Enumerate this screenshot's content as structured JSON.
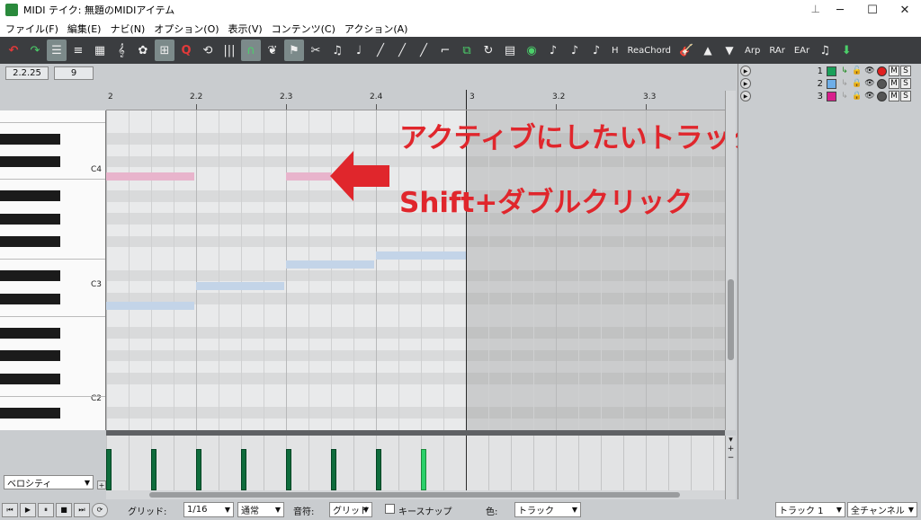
{
  "window": {
    "title": "MIDI テイク: 無題のMIDIアイテム",
    "controls": [
      "─",
      "☐",
      "✕"
    ]
  },
  "menu": [
    "ファイル(F)",
    "編集(E)",
    "ナビ(N)",
    "オプション(O)",
    "表示(V)",
    "コンテンツ(C)",
    "アクション(A)"
  ],
  "toolbar": {
    "labels": {
      "h": "H",
      "reachord": "ReaChord",
      "arp": "Arp",
      "rar": "RAr",
      "ear": "EAr"
    }
  },
  "position": {
    "time": "2.2.25",
    "value": "9"
  },
  "ruler": {
    "marks": [
      "2",
      "2.2",
      "2.3",
      "2.4",
      "3",
      "3.2",
      "3.3"
    ]
  },
  "keys": {
    "c4": "C4",
    "c3": "C3",
    "c2": "C2"
  },
  "annotation": {
    "line1": "アクティブにしたいトラックのノートを",
    "line2": "Shift+ダブルクリック"
  },
  "velocity": {
    "lane": "ベロシティ"
  },
  "bottom": {
    "grid_label": "グリッド:",
    "grid_value": "1/16",
    "mode_value": "通常",
    "note_label": "音符:",
    "note_value": "グリッド",
    "snap_label": "キースナップ",
    "color_label": "色:",
    "color_value": "トラック",
    "track_value": "トラック 1",
    "channel_value": "全チャンネル"
  },
  "tracks": [
    {
      "num": "1",
      "color": "#1aa05a",
      "m": "M",
      "s": "S"
    },
    {
      "num": "2",
      "color": "#6eaee8",
      "m": "M",
      "s": "S"
    },
    {
      "num": "3",
      "color": "#d81e8c",
      "m": "M",
      "s": "S"
    }
  ],
  "colors": {
    "accent": "#e0262c",
    "note_green": "#0e6c3c",
    "note_pink": "#e8b4cc",
    "note_blue": "#c3d4e8"
  }
}
